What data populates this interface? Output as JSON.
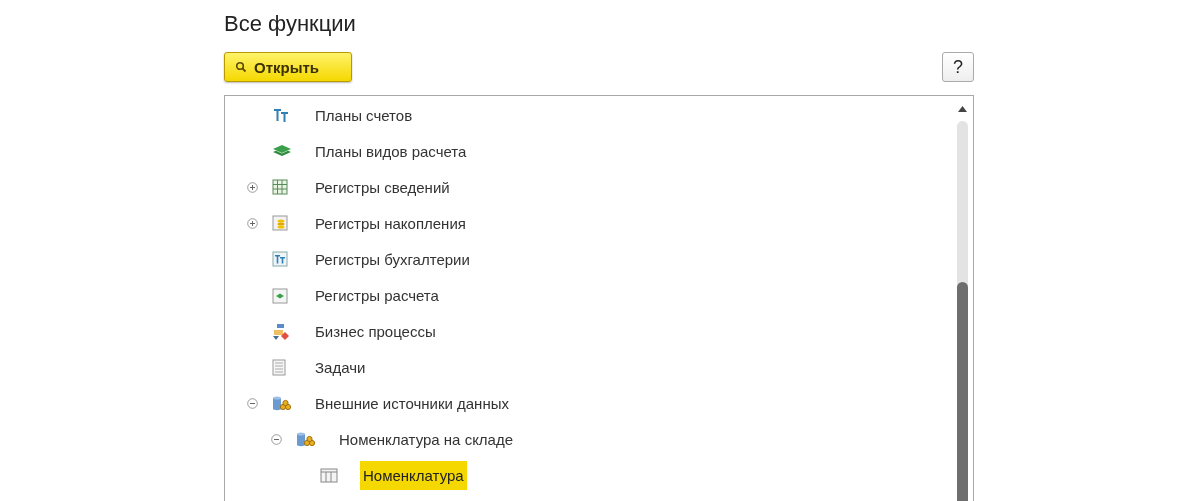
{
  "title": "Все функции",
  "toolbar": {
    "open_button": "Открыть",
    "help_button": "?"
  },
  "tree": [
    {
      "label": "Планы счетов",
      "kind": "accounts",
      "selected": false
    },
    {
      "label": "Планы видов расчета",
      "kind": "layers",
      "selected": false
    },
    {
      "label": "Регистры сведений",
      "kind": "grid",
      "expanded": false,
      "selected": false
    },
    {
      "label": "Регистры накопления",
      "kind": "coins",
      "expanded": false,
      "selected": false
    },
    {
      "label": "Регистры бухгалтерии",
      "kind": "ledger",
      "selected": false
    },
    {
      "label": "Регистры расчета",
      "kind": "calc",
      "selected": false
    },
    {
      "label": "Бизнес процессы",
      "kind": "process",
      "selected": false
    },
    {
      "label": "Задачи",
      "kind": "task",
      "selected": false
    },
    {
      "label": "Внешние источники данных",
      "kind": "database",
      "expanded": true,
      "selected": false,
      "children": [
        {
          "label": "Номенклатура на складе",
          "kind": "database",
          "expanded": true,
          "selected": false,
          "children": [
            {
              "label": "Номенклатура",
              "kind": "table",
              "selected": true
            }
          ]
        }
      ]
    }
  ]
}
